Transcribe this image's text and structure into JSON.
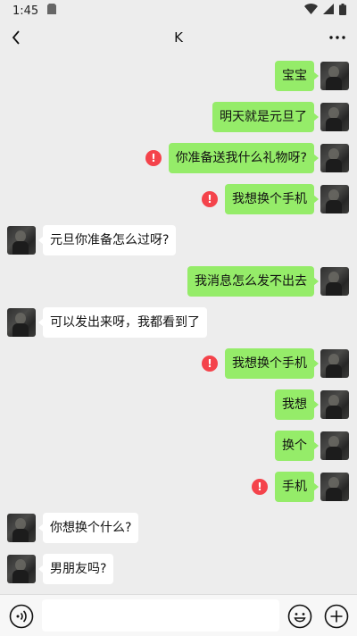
{
  "status_bar": {
    "time": "1:45"
  },
  "header": {
    "title": "K"
  },
  "messages": [
    {
      "side": "out",
      "text": "宝宝",
      "failed": false
    },
    {
      "side": "out",
      "text": "明天就是元旦了",
      "failed": false
    },
    {
      "side": "out",
      "text": "你准备送我什么礼物呀?",
      "failed": true
    },
    {
      "side": "out",
      "text": "我想换个手机",
      "failed": true
    },
    {
      "side": "in",
      "text": "元旦你准备怎么过呀?",
      "failed": false
    },
    {
      "side": "out",
      "text": "我消息怎么发不出去",
      "failed": false
    },
    {
      "side": "in",
      "text": "可以发出来呀，我都看到了",
      "failed": false
    },
    {
      "side": "out",
      "text": "我想换个手机",
      "failed": true
    },
    {
      "side": "out",
      "text": "我想",
      "failed": false
    },
    {
      "side": "out",
      "text": "换个",
      "failed": false
    },
    {
      "side": "out",
      "text": "手机",
      "failed": true
    },
    {
      "side": "in",
      "text": "你想换个什么?",
      "failed": false
    },
    {
      "side": "in",
      "text": "男朋友吗?",
      "failed": false
    }
  ],
  "icons": {
    "back": "chevron-left-icon",
    "more": "more-icon",
    "failed": "exclamation-icon",
    "voice": "voice-icon",
    "emoji": "emoji-icon",
    "plus": "plus-icon"
  },
  "colors": {
    "outgoing_bubble": "#95ec69",
    "incoming_bubble": "#ffffff",
    "failed_icon": "#f4434b",
    "background": "#ededed"
  }
}
